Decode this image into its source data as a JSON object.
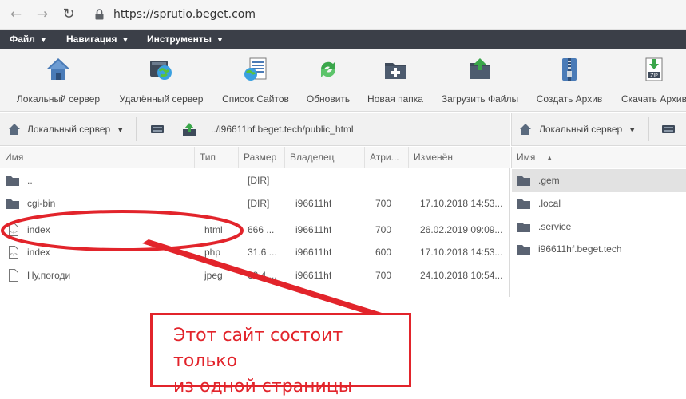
{
  "browser": {
    "url": "https://sprutio.beget.com"
  },
  "menu": {
    "items": [
      "Файл",
      "Навигация",
      "Инструменты"
    ]
  },
  "toolbar": {
    "items": [
      {
        "label": "Локальный сервер",
        "icon": "local-server-icon"
      },
      {
        "label": "Удалённый сервер",
        "icon": "remote-server-icon"
      },
      {
        "label": "Список Сайтов",
        "icon": "sites-list-icon"
      },
      {
        "label": "Обновить",
        "icon": "refresh-icon"
      },
      {
        "label": "Новая папка",
        "icon": "new-folder-icon"
      },
      {
        "label": "Загрузить Файлы",
        "icon": "upload-icon"
      },
      {
        "label": "Создать Архив",
        "icon": "archive-icon"
      },
      {
        "label": "Скачать Архив",
        "icon": "download-archive-icon"
      }
    ]
  },
  "left_panel": {
    "server": "Локальный сервер",
    "path": "../i96611hf.beget.tech/public_html",
    "columns": [
      "Имя",
      "Тип",
      "Размер",
      "Владелец",
      "Атри...",
      "Изменён"
    ],
    "rows": [
      {
        "name": "..",
        "type": "",
        "size": "[DIR]",
        "owner": "",
        "attr": "",
        "modified": "",
        "kind": "folder"
      },
      {
        "name": "cgi-bin",
        "type": "",
        "size": "[DIR]",
        "owner": "i96611hf",
        "attr": "700",
        "modified": "17.10.2018 14:53...",
        "kind": "folder"
      },
      {
        "name": "index",
        "type": "html",
        "size": "666 ...",
        "owner": "i96611hf",
        "attr": "700",
        "modified": "26.02.2019 09:09...",
        "kind": "file"
      },
      {
        "name": "index",
        "type": "php",
        "size": "31.6 ...",
        "owner": "i96611hf",
        "attr": "600",
        "modified": "17.10.2018 14:53...",
        "kind": "file"
      },
      {
        "name": "Ну,погоди",
        "type": "jpeg",
        "size": "69.4 ...",
        "owner": "i96611hf",
        "attr": "700",
        "modified": "24.10.2018 10:54...",
        "kind": "file"
      }
    ]
  },
  "right_panel": {
    "server": "Локальный сервер",
    "column": "Имя",
    "rows": [
      ".gem",
      ".local",
      ".service",
      "i96611hf.beget.tech"
    ]
  },
  "annotation": {
    "line1": "Этот сайт состоит только",
    "line2": "из одной страницы",
    "color": "#e2242b"
  }
}
